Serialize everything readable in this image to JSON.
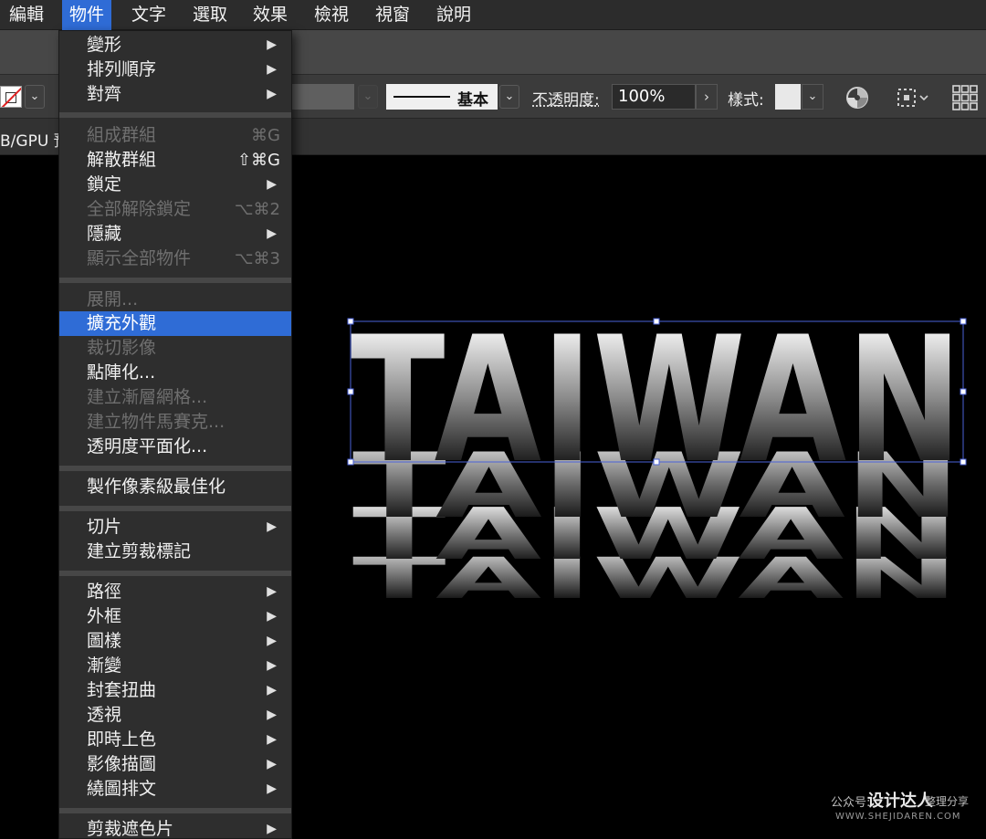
{
  "menubar": {
    "items": [
      "編輯",
      "物件",
      "文字",
      "選取",
      "效果",
      "檢視",
      "視窗",
      "說明"
    ],
    "active_index": 1
  },
  "controlbar": {
    "stroke_label": "基本",
    "opacity_label": "不透明度:",
    "opacity_value": "100%",
    "style_label": "樣式:",
    "dropdown_glyph": "⌄"
  },
  "tabstrip": {
    "tab_text": "B/GPU 預"
  },
  "object_menu": {
    "transform": "變形",
    "arrange": "排列順序",
    "align": "對齊",
    "group": "組成群組",
    "group_sc": "⌘G",
    "ungroup": "解散群組",
    "ungroup_sc": "⇧⌘G",
    "lock": "鎖定",
    "unlock_all": "全部解除鎖定",
    "unlock_all_sc": "⌥⌘2",
    "hide": "隱藏",
    "show_all": "顯示全部物件",
    "show_all_sc": "⌥⌘3",
    "expand": "展開...",
    "expand_appearance": "擴充外觀",
    "crop_image": "裁切影像",
    "rasterize": "點陣化...",
    "create_gradient_mesh": "建立漸層網格...",
    "create_object_mosaic": "建立物件馬賽克...",
    "flatten_transparency": "透明度平面化...",
    "pixel_perfect": "製作像素級最佳化",
    "slice": "切片",
    "create_trim_marks": "建立剪裁標記",
    "path": "路徑",
    "shape": "外框",
    "pattern": "圖樣",
    "blend": "漸變",
    "envelope_distort": "封套扭曲",
    "perspective": "透視",
    "live_paint": "即時上色",
    "image_trace": "影像描圖",
    "text_wrap": "繞圖排文",
    "clipping_mask": "剪裁遮色片",
    "arrow_glyph": "▶"
  },
  "canvas": {
    "artwork_text": "TAIWAN"
  },
  "watermark": {
    "prefix": "公众号:",
    "brand": "设计达人",
    "suffix": "整理分享",
    "url": "WWW.SHEJIDAREN.COM"
  },
  "colors": {
    "menu_highlight": "#2f6cd6",
    "selection_blue": "#4a62d8"
  }
}
